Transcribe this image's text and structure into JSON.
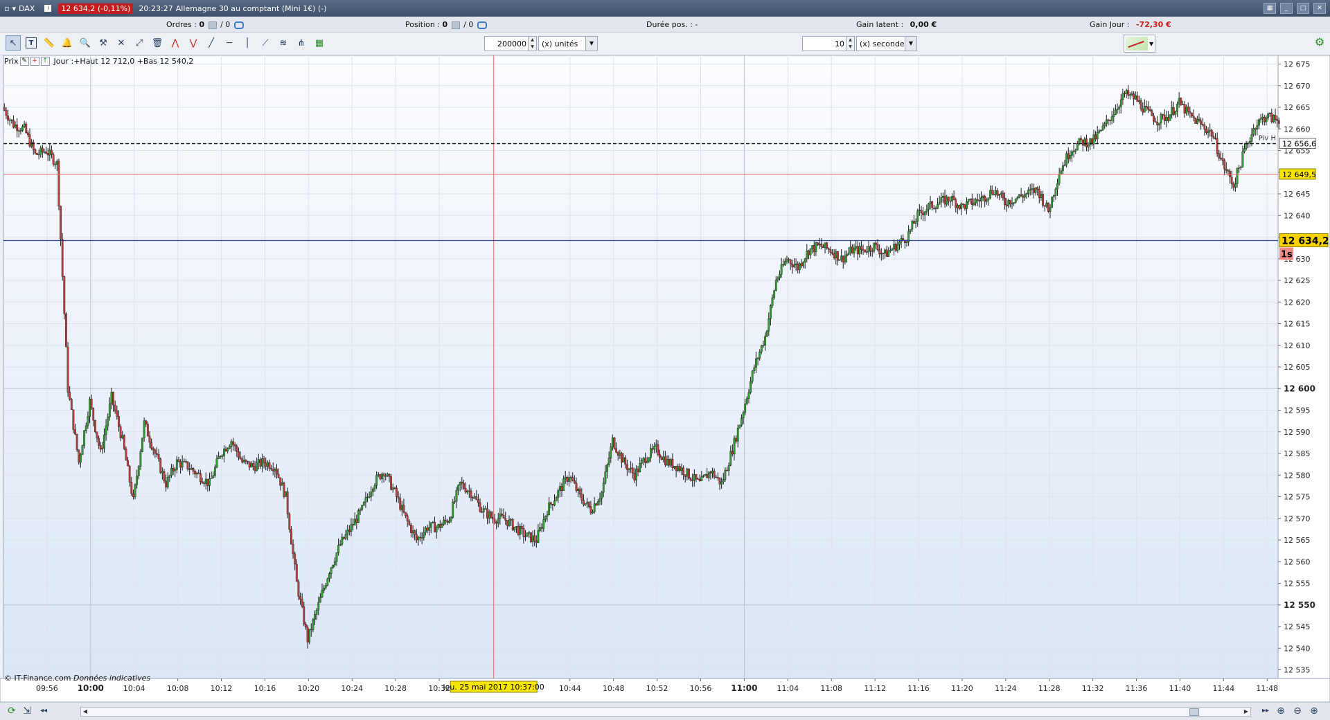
{
  "titlebar": {
    "symbol": "DAX",
    "price_badge": "12 634,2 (-0,11%)",
    "time": "20:23:27",
    "instrument": "Allemagne 30 au comptant (Mini 1€) (-)"
  },
  "status": {
    "orders_label": "Ordres :",
    "orders_value": "0",
    "orders_sep": "/ 0",
    "position_label": "Position :",
    "position_value": "0",
    "position_sep": "/ 0",
    "duration_label": "Durée pos. :",
    "duration_value": "-",
    "latent_label": "Gain latent :",
    "latent_value": "0,00 €",
    "day_label": "Gain Jour :",
    "day_value": "-72,30 €"
  },
  "toolbar": {
    "units_value": "200000",
    "units_select": "(x) unités",
    "seconds_value": "10",
    "seconds_select": "(x) secondes"
  },
  "legend": {
    "label": "Prix",
    "text": "Jour :+Haut 12 712,0 +Bas 12 540,2"
  },
  "credit": {
    "source": "© IT-Finance.com",
    "note": "Données indicatives"
  },
  "chart_data": {
    "type": "candlestick",
    "interval": "10 secondes",
    "ylim": [
      12533,
      12677
    ],
    "y_ticks": [
      12535,
      12540,
      12545,
      12550,
      12555,
      12560,
      12565,
      12570,
      12575,
      12580,
      12585,
      12590,
      12595,
      12600,
      12605,
      12610,
      12615,
      12620,
      12625,
      12630,
      12635,
      12640,
      12645,
      12650,
      12655,
      12660,
      12665,
      12670,
      12675
    ],
    "y_tick_labels": [
      "12 535",
      "12 540",
      "12 545",
      "12 550",
      "12 555",
      "12 560",
      "12 565",
      "12 570",
      "12 575",
      "12 580",
      "12 585",
      "12 590",
      "12 595",
      "12 600",
      "12 605",
      "12 610",
      "12 615",
      "12 620",
      "12 625",
      "12 630",
      "12 635",
      "12 640",
      "12 645",
      "12 650",
      "12 655",
      "12 660",
      "12 665",
      "12 670",
      "12 675"
    ],
    "y_major": [
      12550,
      12600
    ],
    "x_start": "09:52",
    "x_end": "11:49",
    "x_ticks": [
      "09:56",
      "10:00",
      "10:04",
      "10:08",
      "10:12",
      "10:16",
      "10:20",
      "10:24",
      "10:28",
      "10:32",
      "10:44",
      "10:48",
      "10:52",
      "10:56",
      "11:00",
      "11:04",
      "11:08",
      "11:12",
      "11:16",
      "11:20",
      "11:24",
      "11:28",
      "11:32",
      "11:36",
      "11:40",
      "11:44",
      "11:48"
    ],
    "x_major": [
      "10:00",
      "11:00"
    ],
    "crosshair": {
      "x": "10:37:00",
      "label": "jeu. 25 mai 2017 10:37:00"
    },
    "price_line": {
      "value": 12634.2,
      "label": "12 634,2",
      "badge": "1s"
    },
    "pivot_line": {
      "value": 12656.6,
      "label": "12 656,6",
      "name": "Piv H"
    },
    "red_line": {
      "value": 12649.5,
      "label": "12 649,5"
    },
    "path": [
      [
        "09:52",
        12665
      ],
      [
        "09:53",
        12661
      ],
      [
        "09:54",
        12660
      ],
      [
        "09:55",
        12654
      ],
      [
        "09:56",
        12655
      ],
      [
        "09:57",
        12652
      ],
      [
        "09:58",
        12600
      ],
      [
        "09:59",
        12583
      ],
      [
        "10:00",
        12597
      ],
      [
        "10:01",
        12585
      ],
      [
        "10:02",
        12598
      ],
      [
        "10:03",
        12588
      ],
      [
        "10:04",
        12574
      ],
      [
        "10:05",
        12592
      ],
      [
        "10:06",
        12585
      ],
      [
        "10:07",
        12578
      ],
      [
        "10:08",
        12583
      ],
      [
        "10:09",
        12582
      ],
      [
        "10:10",
        12580
      ],
      [
        "10:11",
        12578
      ],
      [
        "10:12",
        12585
      ],
      [
        "10:13",
        12588
      ],
      [
        "10:14",
        12583
      ],
      [
        "10:15",
        12582
      ],
      [
        "10:16",
        12583
      ],
      [
        "10:17",
        12582
      ],
      [
        "10:18",
        12575
      ],
      [
        "10:19",
        12555
      ],
      [
        "10:20",
        12542
      ],
      [
        "10:21",
        12550
      ],
      [
        "10:22",
        12558
      ],
      [
        "10:23",
        12564
      ],
      [
        "10:24",
        12568
      ],
      [
        "10:25",
        12572
      ],
      [
        "10:26",
        12578
      ],
      [
        "10:27",
        12581
      ],
      [
        "10:28",
        12576
      ],
      [
        "10:29",
        12570
      ],
      [
        "10:30",
        12565
      ],
      [
        "10:31",
        12568
      ],
      [
        "10:32",
        12568
      ],
      [
        "10:33",
        12570
      ],
      [
        "10:34",
        12578
      ],
      [
        "10:35",
        12576
      ],
      [
        "10:36",
        12572
      ],
      [
        "10:37",
        12570
      ],
      [
        "10:38",
        12570
      ],
      [
        "10:39",
        12568
      ],
      [
        "10:40",
        12566
      ],
      [
        "10:41",
        12565
      ],
      [
        "10:42",
        12572
      ],
      [
        "10:43",
        12576
      ],
      [
        "10:44",
        12580
      ],
      [
        "10:45",
        12575
      ],
      [
        "10:46",
        12572
      ],
      [
        "10:47",
        12576
      ],
      [
        "10:48",
        12588
      ],
      [
        "10:49",
        12583
      ],
      [
        "10:50",
        12580
      ],
      [
        "10:51",
        12584
      ],
      [
        "10:52",
        12586
      ],
      [
        "10:53",
        12583
      ],
      [
        "10:54",
        12582
      ],
      [
        "10:55",
        12580
      ],
      [
        "10:56",
        12578
      ],
      [
        "10:57",
        12581
      ],
      [
        "10:58",
        12578
      ],
      [
        "10:59",
        12586
      ],
      [
        "11:00",
        12595
      ],
      [
        "11:01",
        12605
      ],
      [
        "11:02",
        12612
      ],
      [
        "11:03",
        12625
      ],
      [
        "11:04",
        12630
      ],
      [
        "11:05",
        12628
      ],
      [
        "11:06",
        12632
      ],
      [
        "11:07",
        12633
      ],
      [
        "11:08",
        12632
      ],
      [
        "11:09",
        12630
      ],
      [
        "11:10",
        12632
      ],
      [
        "11:11",
        12632
      ],
      [
        "11:12",
        12633
      ],
      [
        "11:13",
        12631
      ],
      [
        "11:14",
        12633
      ],
      [
        "11:15",
        12635
      ],
      [
        "11:16",
        12640
      ],
      [
        "11:17",
        12642
      ],
      [
        "11:18",
        12643
      ],
      [
        "11:19",
        12644
      ],
      [
        "11:20",
        12642
      ],
      [
        "11:21",
        12643
      ],
      [
        "11:22",
        12644
      ],
      [
        "11:23",
        12646
      ],
      [
        "11:24",
        12643
      ],
      [
        "11:25",
        12644
      ],
      [
        "11:26",
        12645
      ],
      [
        "11:27",
        12646
      ],
      [
        "11:28",
        12641
      ],
      [
        "11:29",
        12650
      ],
      [
        "11:30",
        12655
      ],
      [
        "11:31",
        12657
      ],
      [
        "11:32",
        12657
      ],
      [
        "11:33",
        12660
      ],
      [
        "11:34",
        12664
      ],
      [
        "11:35",
        12668
      ],
      [
        "11:36",
        12667
      ],
      [
        "11:37",
        12664
      ],
      [
        "11:38",
        12662
      ],
      [
        "11:39",
        12663
      ],
      [
        "11:40",
        12666
      ],
      [
        "11:41",
        12663
      ],
      [
        "11:42",
        12661
      ],
      [
        "11:43",
        12659
      ],
      [
        "11:44",
        12652
      ],
      [
        "11:45",
        12647
      ],
      [
        "11:46",
        12655
      ],
      [
        "11:47",
        12661
      ],
      [
        "11:48",
        12663
      ],
      [
        "11:49",
        12662
      ]
    ]
  }
}
